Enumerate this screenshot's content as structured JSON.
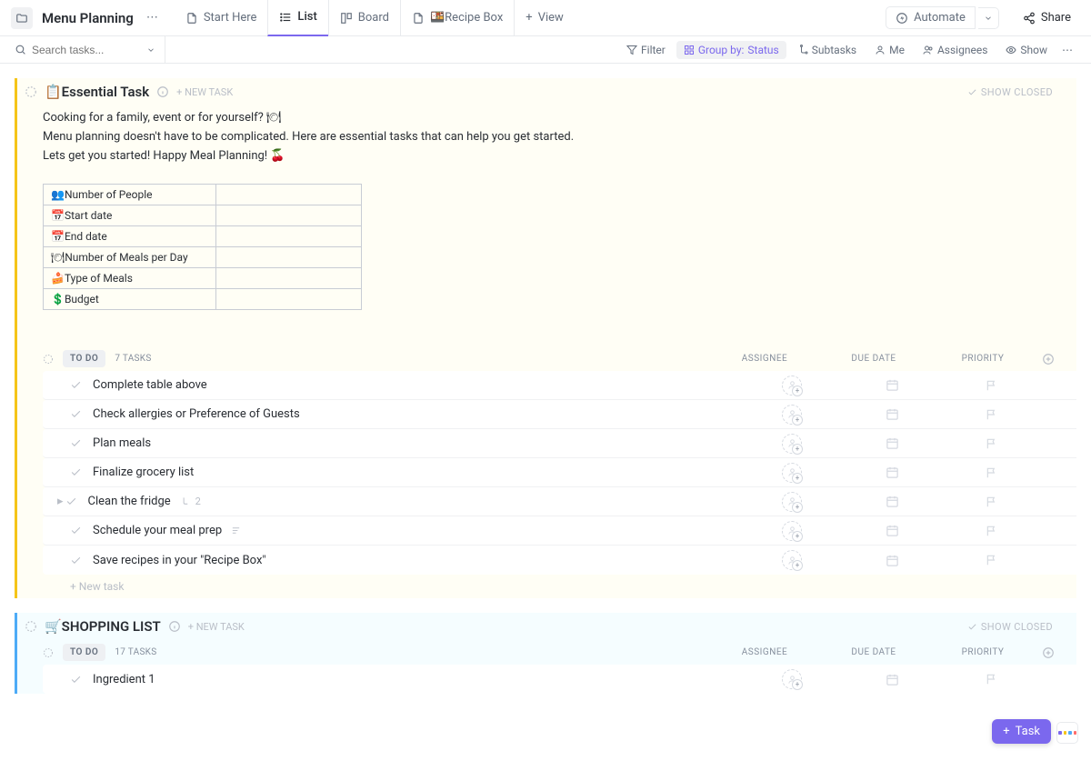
{
  "header": {
    "title": "Menu Planning",
    "tabs": [
      {
        "label": "Start Here"
      },
      {
        "label": "List"
      },
      {
        "label": "Board"
      },
      {
        "label": "🍱Recipe Box"
      }
    ],
    "view_btn": "View",
    "automate": "Automate",
    "share": "Share"
  },
  "filterbar": {
    "search_placeholder": "Search tasks...",
    "filter": "Filter",
    "group_by_label": "Group by:",
    "group_by_value": "Status",
    "subtasks": "Subtasks",
    "me": "Me",
    "assignees": "Assignees",
    "show": "Show"
  },
  "section1": {
    "title": "📋Essential Task",
    "new_task": "+ NEW TASK",
    "show_closed": "SHOW CLOSED",
    "desc_line1": "Cooking for a family, event or for yourself? 🍽",
    "desc_line2": "Menu planning doesn't have to be complicated. Here are essential tasks that can help you get started.",
    "desc_line3": "Lets get you started! Happy Meal Planning! 🍒",
    "table_rows": [
      "👥Number of People",
      "📅Start date",
      "📅End date",
      "🍽Number of Meals per Day",
      "🍰Type of Meals",
      "💲Budget"
    ],
    "status_chip": "TO DO",
    "task_count": "7 TASKS",
    "col_assignee": "ASSIGNEE",
    "col_due": "DUE DATE",
    "col_priority": "PRIORITY",
    "tasks": [
      {
        "name": "Complete table above"
      },
      {
        "name": "Check allergies or Preference of Guests"
      },
      {
        "name": "Plan meals"
      },
      {
        "name": "Finalize grocery list"
      },
      {
        "name": "Clean the fridge",
        "subtasks": "2",
        "expandable": true
      },
      {
        "name": "Schedule your meal prep",
        "has_desc": true
      },
      {
        "name": "Save recipes in your \"Recipe Box\""
      }
    ],
    "new_task_row": "+ New task"
  },
  "section2": {
    "title": "🛒SHOPPING LIST",
    "new_task": "+ NEW TASK",
    "show_closed": "SHOW CLOSED",
    "status_chip": "TO DO",
    "task_count": "17 TASKS",
    "col_assignee": "ASSIGNEE",
    "col_due": "DUE DATE",
    "col_priority": "PRIORITY",
    "tasks": [
      {
        "name": "Ingredient 1"
      }
    ]
  },
  "float": {
    "task": "Task"
  }
}
